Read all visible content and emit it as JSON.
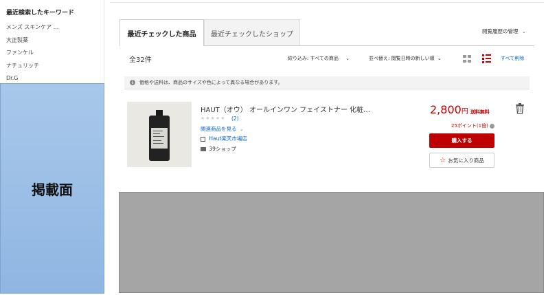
{
  "sidebar": {
    "title": "最近検索したキーワード",
    "keywords": [
      "メンズ スキンケア ...",
      "大正製薬",
      "ファンケル",
      "ナチュリッチ",
      "Dr.G"
    ],
    "ad_label": "掲載面"
  },
  "tabs": [
    {
      "label": "最近チェックした商品",
      "active": true
    },
    {
      "label": "最近チェックしたショップ",
      "active": false
    }
  ],
  "history_manage": "閲覧履歴の管理",
  "toolbar": {
    "count": "全32件",
    "filter_label": "絞り込み: すべての商品",
    "sort_label": "並べ替え: 閲覧日時の新しい順",
    "delete_all": "すべて削除"
  },
  "notice": "価格や送料は、商品のサイズや色によって異なる場合があります。",
  "product": {
    "name": "HAUT（オウ） オールインワン フェイストナー 化粧…",
    "stars": "★★★★★",
    "review_count": "(2)",
    "related": "関連商品を見る",
    "shop": "Haut楽天市場店",
    "shop_count": "39ショップ",
    "price": "2,800",
    "price_unit": "円",
    "shipping": "送料無料",
    "points": "25ポイント(1倍)",
    "buy_label": "購入する",
    "fav_label": "お気に入り商品"
  },
  "colors": {
    "accent": "#bf0000",
    "link": "#0066cc",
    "ad_panel": "#8fb6e2",
    "gray_block": "#a5a5a5"
  }
}
